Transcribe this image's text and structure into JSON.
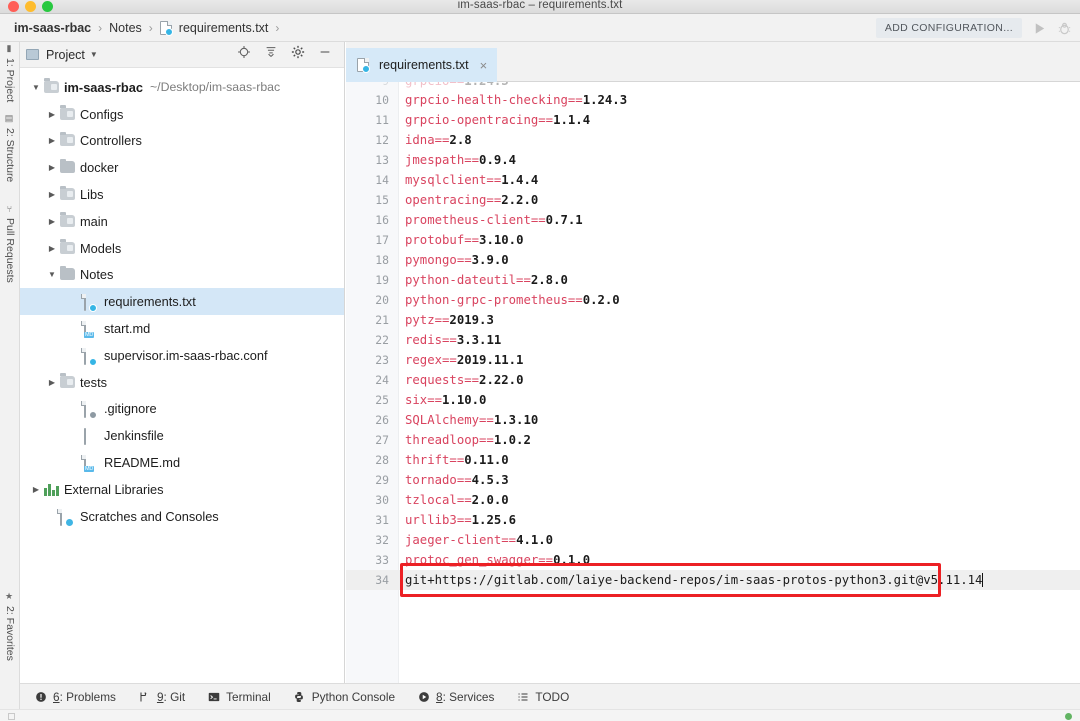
{
  "window": {
    "title": "im-saas-rbac – requirements.txt",
    "traffic_lights": [
      "close-red",
      "minimize-yellow",
      "zoom-green"
    ]
  },
  "breadcrumb": {
    "items": [
      "im-saas-rbac",
      "Notes",
      "requirements.txt"
    ],
    "separator": "›",
    "file_icon": "txt-config-file-icon"
  },
  "toolbar": {
    "add_configuration_label": "ADD CONFIGURATION...",
    "run_icon": "run-play-icon",
    "debug_icon": "debug-bug-icon"
  },
  "left_strip": {
    "top_items": [
      {
        "label": "1: Project",
        "icon": "project-icon"
      },
      {
        "label": "2: Structure",
        "icon": "structure-icon"
      },
      {
        "label": "Pull Requests",
        "icon": "pull-request-icon"
      }
    ],
    "bottom_items": [
      {
        "label": "2: Favorites",
        "icon": "star-icon"
      }
    ]
  },
  "project_panel": {
    "title": "Project",
    "dropdown_icon": "chevron-down-icon",
    "tools": [
      "locate-target-icon",
      "collapse-all-icon",
      "settings-gear-icon",
      "hide-minimize-icon"
    ],
    "tree": [
      {
        "label": "im-saas-rbac",
        "path": "~/Desktop/im-saas-rbac",
        "icon": "folder-open-icon",
        "indent": 0,
        "state": "expanded",
        "bold": true,
        "selected": false
      },
      {
        "label": "Configs",
        "path": "",
        "icon": "folder-icon",
        "indent": 1,
        "state": "collapsed",
        "bold": false,
        "selected": false
      },
      {
        "label": "Controllers",
        "path": "",
        "icon": "folder-icon",
        "indent": 1,
        "state": "collapsed",
        "bold": false,
        "selected": false
      },
      {
        "label": "docker",
        "path": "",
        "icon": "folder-plain-icon",
        "indent": 1,
        "state": "collapsed",
        "bold": false,
        "selected": false
      },
      {
        "label": "Libs",
        "path": "",
        "icon": "folder-icon",
        "indent": 1,
        "state": "collapsed",
        "bold": false,
        "selected": false
      },
      {
        "label": "main",
        "path": "",
        "icon": "folder-icon",
        "indent": 1,
        "state": "collapsed",
        "bold": false,
        "selected": false
      },
      {
        "label": "Models",
        "path": "",
        "icon": "folder-icon",
        "indent": 1,
        "state": "collapsed",
        "bold": false,
        "selected": false
      },
      {
        "label": "Notes",
        "path": "",
        "icon": "folder-plain-icon",
        "indent": 1,
        "state": "expanded",
        "bold": false,
        "selected": false
      },
      {
        "label": "requirements.txt",
        "path": "",
        "icon": "txt-config-file-icon",
        "indent": 2,
        "state": "leaf",
        "bold": false,
        "selected": true
      },
      {
        "label": "start.md",
        "path": "",
        "icon": "markdown-file-icon",
        "indent": 2,
        "state": "leaf",
        "bold": false,
        "selected": false
      },
      {
        "label": "supervisor.im-saas-rbac.conf",
        "path": "",
        "icon": "txt-config-file-icon",
        "indent": 2,
        "state": "leaf",
        "bold": false,
        "selected": false
      },
      {
        "label": "tests",
        "path": "",
        "icon": "folder-icon",
        "indent": 1,
        "state": "collapsed",
        "bold": false,
        "selected": false
      },
      {
        "label": ".gitignore",
        "path": "",
        "icon": "ignored-file-icon",
        "indent": 1,
        "state": "leaf",
        "bold": false,
        "selected": false
      },
      {
        "label": "Jenkinsfile",
        "path": "",
        "icon": "jenkins-file-icon",
        "indent": 1,
        "state": "leaf",
        "bold": false,
        "selected": false
      },
      {
        "label": "README.md",
        "path": "",
        "icon": "markdown-file-icon",
        "indent": 1,
        "state": "leaf",
        "bold": false,
        "selected": false
      },
      {
        "label": "External Libraries",
        "path": "",
        "icon": "libraries-icon",
        "indent": 0,
        "state": "collapsed",
        "bold": false,
        "selected": false
      },
      {
        "label": "Scratches and Consoles",
        "path": "",
        "icon": "scratches-icon",
        "indent": 0,
        "state": "leaf",
        "bold": false,
        "selected": false
      }
    ]
  },
  "editor": {
    "tab": {
      "label": "requirements.txt",
      "icon": "txt-config-file-icon",
      "close_icon": "close-icon",
      "active": true
    },
    "first_visible_line": 10,
    "lines": [
      {
        "num": 10,
        "pkg": "grpcio-health-checking==",
        "ver": "1.24.3"
      },
      {
        "num": 11,
        "pkg": "grpcio-opentracing==",
        "ver": "1.1.4"
      },
      {
        "num": 12,
        "pkg": "idna==",
        "ver": "2.8"
      },
      {
        "num": 13,
        "pkg": "jmespath==",
        "ver": "0.9.4"
      },
      {
        "num": 14,
        "pkg": "mysqlclient==",
        "ver": "1.4.4"
      },
      {
        "num": 15,
        "pkg": "opentracing==",
        "ver": "2.2.0"
      },
      {
        "num": 16,
        "pkg": "prometheus-client==",
        "ver": "0.7.1"
      },
      {
        "num": 17,
        "pkg": "protobuf==",
        "ver": "3.10.0"
      },
      {
        "num": 18,
        "pkg": "pymongo==",
        "ver": "3.9.0"
      },
      {
        "num": 19,
        "pkg": "python-dateutil==",
        "ver": "2.8.0"
      },
      {
        "num": 20,
        "pkg": "python-grpc-prometheus==",
        "ver": "0.2.0"
      },
      {
        "num": 21,
        "pkg": "pytz==",
        "ver": "2019.3"
      },
      {
        "num": 22,
        "pkg": "redis==",
        "ver": "3.3.11"
      },
      {
        "num": 23,
        "pkg": "regex==",
        "ver": "2019.11.1"
      },
      {
        "num": 24,
        "pkg": "requests==",
        "ver": "2.22.0"
      },
      {
        "num": 25,
        "pkg": "six==",
        "ver": "1.10.0"
      },
      {
        "num": 26,
        "pkg": "SQLAlchemy==",
        "ver": "1.3.10"
      },
      {
        "num": 27,
        "pkg": "threadloop==",
        "ver": "1.0.2"
      },
      {
        "num": 28,
        "pkg": "thrift==",
        "ver": "0.11.0"
      },
      {
        "num": 29,
        "pkg": "tornado==",
        "ver": "4.5.3"
      },
      {
        "num": 30,
        "pkg": "tzlocal==",
        "ver": "2.0.0"
      },
      {
        "num": 31,
        "pkg": "urllib3==",
        "ver": "1.25.6"
      },
      {
        "num": 32,
        "pkg": "jaeger-client==",
        "ver": "4.1.0"
      },
      {
        "num": 33,
        "pkg": "protoc_gen_swagger==",
        "ver": "0.1.0"
      }
    ],
    "active_line": {
      "num": 34,
      "text": "git+https://gitlab.com/laiye-backend-repos/im-saas-protos-python3.git@v5.11.14",
      "highlighted": true,
      "has_caret": true,
      "annotation_color": "#ec2024"
    }
  },
  "status_bar": {
    "items": [
      {
        "shortcut": "6",
        "label": ": Problems",
        "icon": "problems-icon"
      },
      {
        "shortcut": "9",
        "label": ": Git",
        "icon": "git-branch-icon"
      },
      {
        "shortcut": "",
        "label": "Terminal",
        "icon": "terminal-icon"
      },
      {
        "shortcut": "",
        "label": "Python Console",
        "icon": "python-icon"
      },
      {
        "shortcut": "8",
        "label": ": Services",
        "icon": "services-icon"
      },
      {
        "shortcut": "",
        "label": "TODO",
        "icon": "todo-list-icon"
      }
    ]
  }
}
